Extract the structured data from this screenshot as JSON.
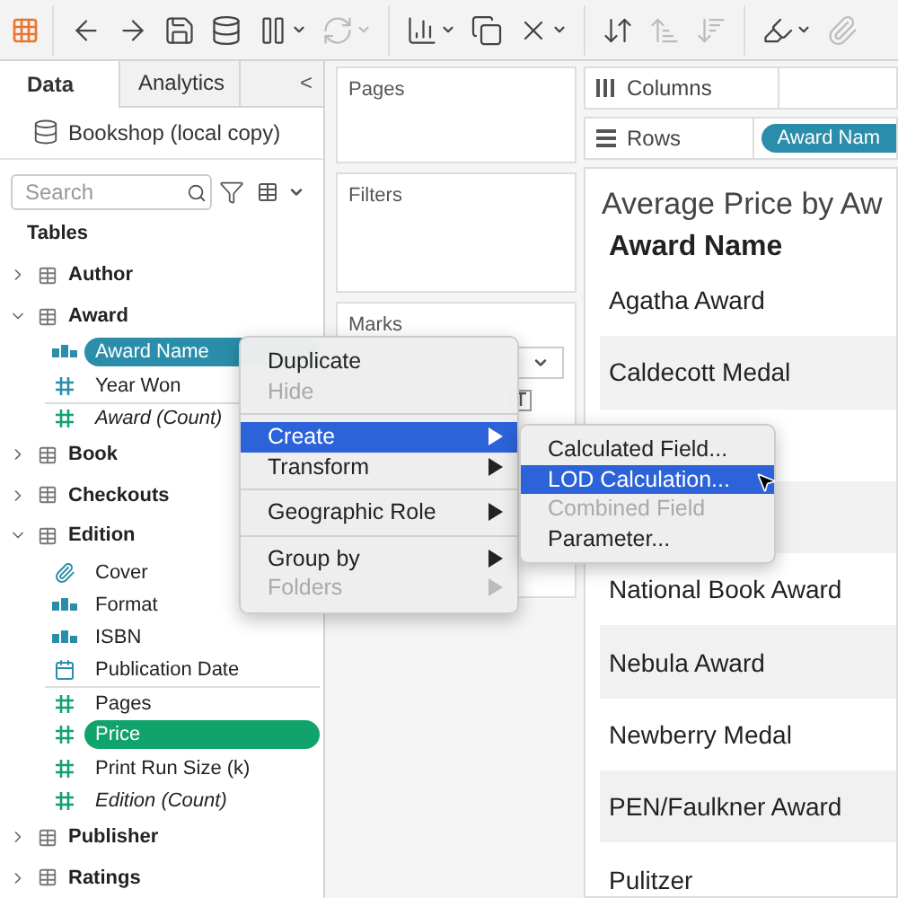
{
  "toolbar": {
    "items": [
      {
        "kind": "logo"
      },
      {
        "kind": "back"
      },
      {
        "kind": "forward"
      },
      {
        "kind": "save"
      },
      {
        "kind": "add-source"
      },
      {
        "kind": "pause",
        "dropdown": true
      },
      {
        "kind": "refresh",
        "disabled": true,
        "dropdown": true
      },
      {
        "kind": "new-sheet",
        "dropdown": true
      },
      {
        "kind": "duplicate"
      },
      {
        "kind": "clear",
        "dropdown": true
      },
      {
        "kind": "swap"
      },
      {
        "kind": "sort-asc",
        "disabled": true
      },
      {
        "kind": "sort-desc",
        "disabled": true
      },
      {
        "kind": "highlight",
        "dropdown": true
      },
      {
        "kind": "attach",
        "disabled": true
      }
    ]
  },
  "side_tabs": [
    {
      "label": "Data",
      "selected": true
    },
    {
      "label": "Analytics",
      "selected": false
    }
  ],
  "collapse": "<",
  "data_source": "Bookshop (local copy)",
  "search": {
    "placeholder": "Search"
  },
  "tables_heading": "Tables",
  "tables": [
    {
      "name": "Author",
      "expanded": false
    },
    {
      "name": "Award",
      "expanded": true,
      "fields": [
        {
          "name": "Award Name",
          "kind": "string",
          "color": "#2a8eaa",
          "selected": true
        },
        {
          "name": "Year Won",
          "kind": "number",
          "color": "#2a8eaa",
          "selected": false
        },
        {
          "name": "Award (Count)",
          "kind": "number",
          "color": "#11a36c",
          "selected": false,
          "generated": true,
          "divider_before": true
        }
      ]
    },
    {
      "name": "Book",
      "expanded": false
    },
    {
      "name": "Checkouts",
      "expanded": false
    },
    {
      "name": "Edition",
      "expanded": true,
      "fields": [
        {
          "name": "Cover",
          "kind": "attachment",
          "color": "#2a8eaa",
          "selected": false
        },
        {
          "name": "Format",
          "kind": "string",
          "color": "#2a8eaa",
          "selected": false
        },
        {
          "name": "ISBN",
          "kind": "string",
          "color": "#2a8eaa",
          "selected": false
        },
        {
          "name": "Publication Date",
          "kind": "date",
          "color": "#2a8eaa",
          "selected": false
        },
        {
          "name": "Pages",
          "kind": "number",
          "color": "#11a36c",
          "selected": false,
          "divider_before": true
        },
        {
          "name": "Price",
          "kind": "number",
          "color": "#11a36c",
          "selected": true
        },
        {
          "name": "Print Run Size (k)",
          "kind": "number",
          "color": "#11a36c",
          "selected": false
        },
        {
          "name": "Edition (Count)",
          "kind": "number",
          "color": "#11a36c",
          "selected": false,
          "generated": true
        }
      ]
    },
    {
      "name": "Publisher",
      "expanded": false
    },
    {
      "name": "Ratings",
      "expanded": false
    }
  ],
  "cards": {
    "pages": "Pages",
    "filters": "Filters",
    "marks": "Marks"
  },
  "shelves": [
    {
      "kind": "columns",
      "label": "Columns"
    },
    {
      "kind": "rows",
      "label": "Rows",
      "pills": [
        "Award Nam"
      ]
    }
  ],
  "viz": {
    "title": "Average Price by Aw",
    "header": "Award Name",
    "rows": [
      {
        "label": "Agatha Award"
      },
      {
        "label": "Caldecott Medal"
      },
      {},
      {},
      {
        "label": "National Book Award"
      },
      {
        "label": "Nebula Award"
      },
      {
        "label": "Newberry Medal"
      },
      {
        "label": "PEN/Faulkner Award"
      },
      {
        "label": "Pulitzer"
      }
    ]
  },
  "context_menu": [
    [
      {
        "label": "Duplicate",
        "disabled": false,
        "selected": false,
        "submenu": false
      },
      {
        "label": "Hide",
        "disabled": true,
        "selected": false,
        "submenu": false
      }
    ],
    [
      {
        "label": "Create",
        "disabled": false,
        "selected": true,
        "submenu": true
      },
      {
        "label": "Transform",
        "disabled": false,
        "selected": false,
        "submenu": true
      }
    ],
    [
      {
        "label": "Geographic Role",
        "disabled": false,
        "selected": false,
        "submenu": true
      }
    ],
    [
      {
        "label": "Group by",
        "disabled": false,
        "selected": false,
        "submenu": true
      },
      {
        "label": "Folders",
        "disabled": true,
        "selected": false,
        "submenu": true
      }
    ]
  ],
  "submenu": [
    {
      "label": "Calculated Field...",
      "disabled": false,
      "selected": false
    },
    {
      "label": "LOD Calculation...",
      "disabled": false,
      "selected": true
    },
    {
      "label": "Combined Field",
      "disabled": true,
      "selected": false
    },
    {
      "label": "Parameter...",
      "disabled": false,
      "selected": false
    }
  ]
}
